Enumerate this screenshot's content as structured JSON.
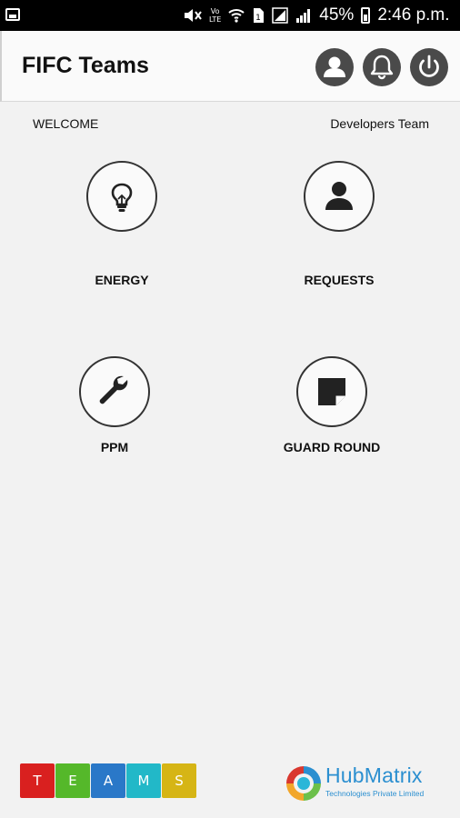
{
  "status_bar": {
    "battery_percent": "45%",
    "time": "2:46 p.m.",
    "network_label_1": "Vo",
    "network_label_2": "LTE",
    "icons": [
      "gallery-icon",
      "mute-icon",
      "volte-icon",
      "wifi-icon",
      "sim-icon",
      "signal-icon",
      "battery-icon"
    ]
  },
  "app_bar": {
    "title": "FIFC Teams",
    "actions": [
      "profile-icon",
      "bell-icon",
      "power-icon"
    ]
  },
  "header": {
    "welcome": "WELCOME",
    "team": "Developers Team"
  },
  "tiles": [
    {
      "label": "ENERGY",
      "icon": "lightbulb-icon"
    },
    {
      "label": "REQUESTS",
      "icon": "person-icon"
    },
    {
      "label": "PPM",
      "icon": "wrench-icon"
    },
    {
      "label": "GUARD ROUND",
      "icon": "note-icon"
    }
  ],
  "footer": {
    "teams_letters": [
      "T",
      "E",
      "A",
      "M",
      "S"
    ],
    "teams_colors": [
      "#d9201f",
      "#55b82a",
      "#2a78c8",
      "#22b8c8",
      "#d6b515"
    ],
    "hub_name": "HubMatrix",
    "hub_subtitle": "Technologies Private Limited"
  }
}
